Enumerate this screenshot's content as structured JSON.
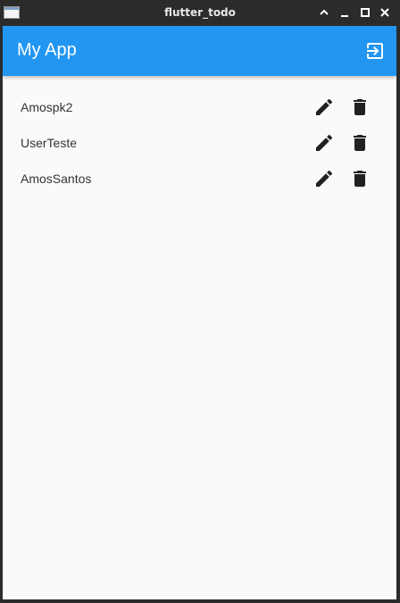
{
  "window": {
    "title": "flutter_todo",
    "controls": [
      "shade-up-icon",
      "minimize-icon",
      "maximize-icon",
      "close-icon"
    ]
  },
  "appbar": {
    "title": "My App",
    "action_icon": "logout-icon",
    "color": "#2196f3"
  },
  "users": [
    {
      "name": "Amospk2"
    },
    {
      "name": "UserTeste"
    },
    {
      "name": "AmosSantos"
    }
  ],
  "row_actions": [
    "edit-icon",
    "delete-icon"
  ]
}
